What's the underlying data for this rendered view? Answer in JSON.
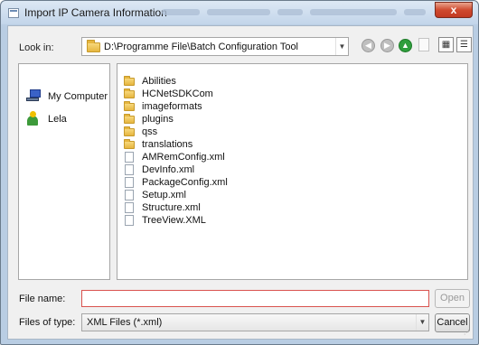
{
  "window": {
    "title": "Import IP Camera Information",
    "close_label": "x"
  },
  "toolbar": {
    "look_in_label": "Look in:",
    "look_in_path": "D:\\Programme File\\Batch Configuration Tool",
    "icons": [
      "back-icon",
      "forward-icon",
      "up-folder-icon",
      "new-folder-icon",
      "list-view-icon",
      "detail-view-icon"
    ]
  },
  "sidebar": {
    "items": [
      {
        "label": "My Computer",
        "icon": "computer-icon"
      },
      {
        "label": "Lela",
        "icon": "user-icon"
      }
    ]
  },
  "files": {
    "folders": [
      "Abilities",
      "HCNetSDKCom",
      "imageformats",
      "plugins",
      "qss",
      "translations"
    ],
    "documents": [
      "AMRemConfig.xml",
      "DevInfo.xml",
      "PackageConfig.xml",
      "Setup.xml",
      "Structure.xml",
      "TreeView.XML"
    ]
  },
  "bottom": {
    "file_name_label": "File name:",
    "file_name_value": "",
    "open_label": "Open",
    "files_of_type_label": "Files of type:",
    "files_of_type_value": "XML Files (*.xml)",
    "cancel_label": "Cancel"
  },
  "colors": {
    "titlebar": "#c3d5ea",
    "close": "#cf4a2f",
    "folder": "#e6b63f",
    "filename_border": "#d9534f"
  }
}
